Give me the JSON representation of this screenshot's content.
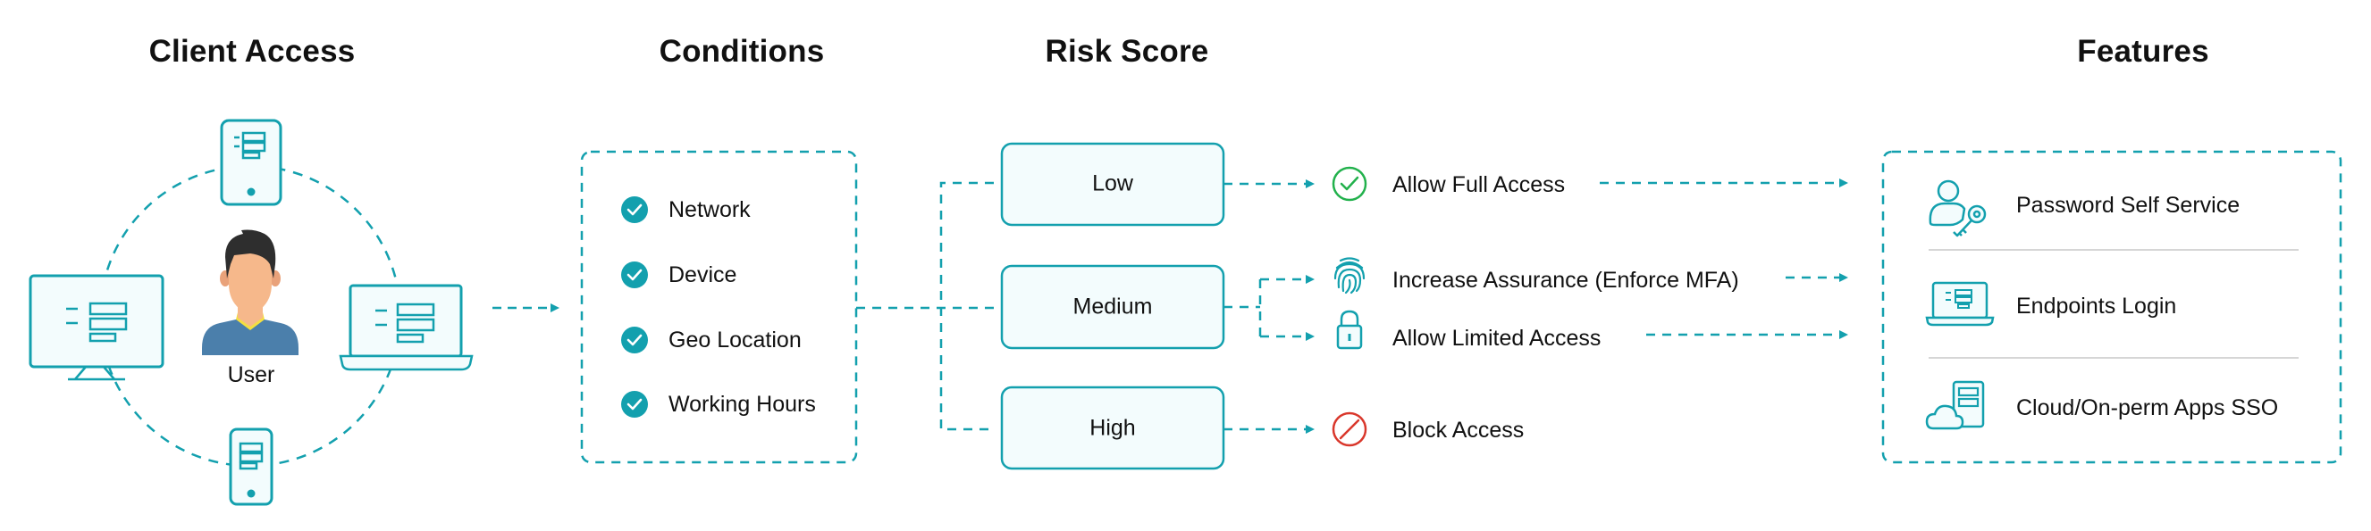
{
  "headings": {
    "client_access": "Client Access",
    "conditions": "Conditions",
    "risk_score": "Risk Score",
    "features": "Features"
  },
  "client_access": {
    "user_label": "User",
    "devices": [
      "tablet",
      "desktop-monitor",
      "laptop",
      "mobile-phone"
    ]
  },
  "conditions": {
    "items": [
      {
        "label": "Network",
        "icon": "check-circle-icon"
      },
      {
        "label": "Device",
        "icon": "check-circle-icon"
      },
      {
        "label": "Geo Location",
        "icon": "check-circle-icon"
      },
      {
        "label": "Working Hours",
        "icon": "check-circle-icon"
      }
    ]
  },
  "risk_levels": [
    {
      "label": "Low"
    },
    {
      "label": "Medium"
    },
    {
      "label": "High"
    }
  ],
  "actions": [
    {
      "label": "Allow Full Access",
      "icon": "check-outline-icon",
      "color": "#22b14c"
    },
    {
      "label": "Increase Assurance (Enforce MFA)",
      "icon": "fingerprint-icon",
      "color": "#13a0ae"
    },
    {
      "label": "Allow Limited Access",
      "icon": "lock-icon",
      "color": "#13a0ae"
    },
    {
      "label": "Block Access",
      "icon": "block-icon",
      "color": "#d9372b"
    }
  ],
  "features": [
    {
      "label": "Password Self Service",
      "icon": "user-key-icon"
    },
    {
      "label": "Endpoints Login",
      "icon": "laptop-icon"
    },
    {
      "label": "Cloud/On-perm Apps SSO",
      "icon": "cloud-server-icon"
    }
  ],
  "colors": {
    "accent": "#13a0ae",
    "box_fill": "#f3fcfd",
    "success": "#22b14c",
    "danger": "#d9372b",
    "divider": "#d6d6d6"
  }
}
